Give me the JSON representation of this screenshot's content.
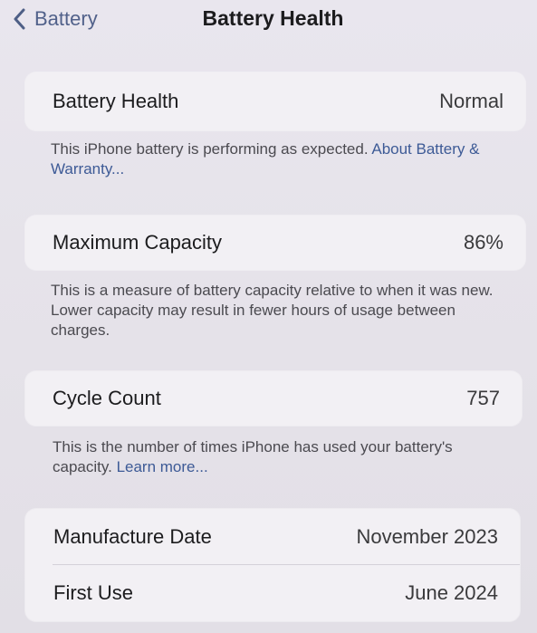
{
  "nav": {
    "back_label": "Battery",
    "title": "Battery Health"
  },
  "health": {
    "label": "Battery Health",
    "value": "Normal",
    "footer_text": "This iPhone battery is performing as expected. ",
    "footer_link": "About Battery & Warranty..."
  },
  "capacity": {
    "label": "Maximum Capacity",
    "value": "86%",
    "footer_text": "This is a measure of battery capacity relative to when it was new. Lower capacity may result in fewer hours of usage between charges."
  },
  "cycles": {
    "label": "Cycle Count",
    "value": "757",
    "footer_text": "This is the number of times iPhone has used your battery's capacity. ",
    "footer_link": "Learn more..."
  },
  "dates": {
    "manufacture_label": "Manufacture Date",
    "manufacture_value": "November 2023",
    "first_use_label": "First Use",
    "first_use_value": "June 2024"
  },
  "colors": {
    "link": "#3d5a96",
    "background": "#e7e4eb",
    "group": "#f2f0f4"
  }
}
